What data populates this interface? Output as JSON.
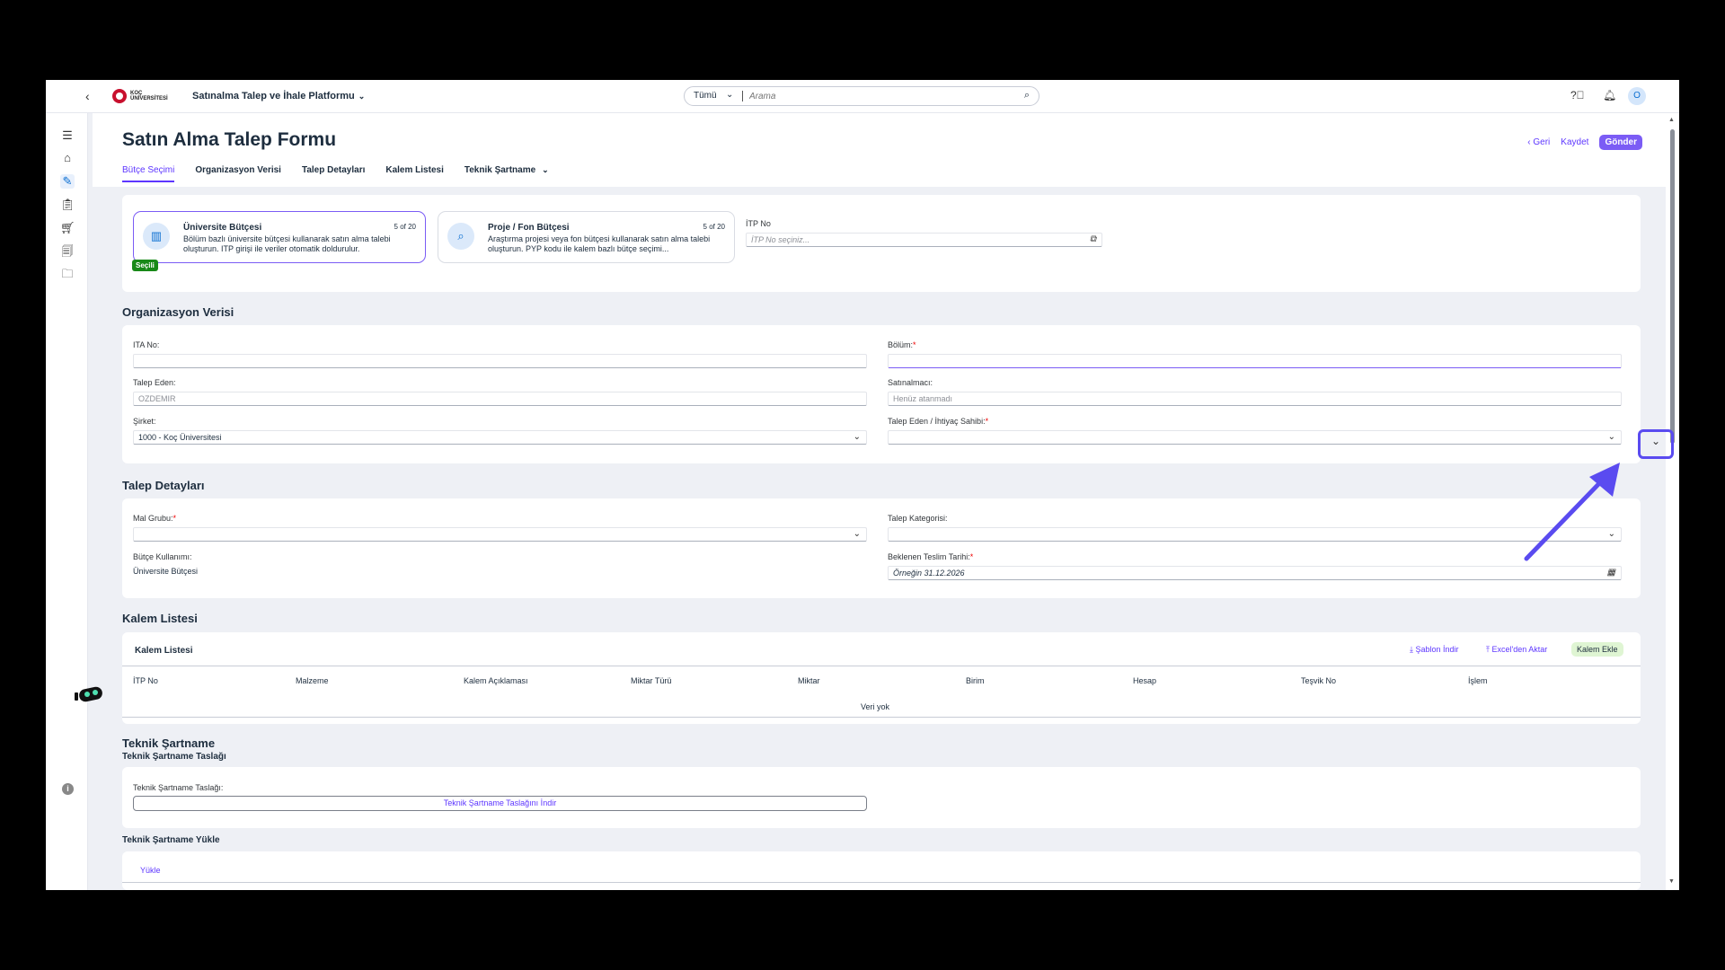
{
  "shell": {
    "logo_line1": "KOÇ",
    "logo_line2": "ÜNİVERSİTESİ",
    "app_title": "Satınalma Talep ve İhale Platformu",
    "search_scope": "Tümü",
    "search_placeholder": "Arama",
    "avatar_initial": "O"
  },
  "header": {
    "title": "Satın Alma Talep Formu",
    "back_label": "Geri",
    "save_label": "Kaydet",
    "submit_label": "Gönder",
    "tabs": [
      {
        "label": "Bütçe Seçimi"
      },
      {
        "label": "Organizasyon Verisi"
      },
      {
        "label": "Talep Detayları"
      },
      {
        "label": "Kalem Listesi"
      },
      {
        "label": "Teknik Şartname"
      }
    ]
  },
  "budget": {
    "tiles": [
      {
        "title": "Üniversite Bütçesi",
        "count": "5 of 20",
        "desc": "Bölüm bazlı üniversite bütçesi kullanarak satın alma talebi oluşturun. ITP girişi ile veriler otomatik doldurulur."
      },
      {
        "title": "Proje / Fon Bütçesi",
        "count": "5 of 20",
        "desc": "Araştırma projesi veya fon bütçesi kullanarak satın alma talebi oluşturun. PYP kodu ile kalem bazlı bütçe seçimi..."
      }
    ],
    "selected_badge": "Seçili",
    "itp_label": "İTP No",
    "itp_placeholder": "İTP No seçiniz..."
  },
  "org": {
    "section_title": "Organizasyon Verisi",
    "ita_label": "ITA No:",
    "bolum_label": "Bölüm:",
    "talep_eden_label": "Talep Eden:",
    "talep_eden_value": "OZDEMIR",
    "satinalmaci_label": "Satınalmacı:",
    "satinalmaci_value": "Henüz atanmadı",
    "sirket_label": "Şirket:",
    "sirket_value": "1000 - Koç Üniversitesi",
    "ihtiyac_label": "Talep Eden / İhtiyaç Sahibi:"
  },
  "details": {
    "section_title": "Talep Detayları",
    "mal_grubu_label": "Mal Grubu:",
    "kategori_label": "Talep Kategorisi:",
    "butce_label": "Bütçe Kullanımı:",
    "butce_value": "Üniversite Bütçesi",
    "teslim_label": "Beklenen Teslim Tarihi:",
    "teslim_placeholder": "Örneğin 31.12.2026"
  },
  "items": {
    "section_title": "Kalem Listesi",
    "table_title": "Kalem Listesi",
    "template_link": "Şablon İndir",
    "excel_link": "Excel'den Aktar",
    "add_button": "Kalem Ekle",
    "columns": [
      "İTP No",
      "Malzeme",
      "Kalem Açıklaması",
      "Miktar Türü",
      "Miktar",
      "Birim",
      "Hesap",
      "Teşvik No",
      "İşlem"
    ],
    "empty_text": "Veri yok"
  },
  "spec": {
    "section_title": "Teknik Şartname",
    "draft_title": "Teknik Şartname Taslağı",
    "draft_label": "Teknik Şartname Taslağı:",
    "draft_button": "Teknik Şartname Taslağını İndir",
    "upload_title": "Teknik Şartname Yükle",
    "upload_link": "Yükle"
  },
  "colors": {
    "accent": "#5d36ff",
    "primary_button": "#7b5cf5",
    "selected_badge": "#188918",
    "annotation": "#5a4bf0"
  }
}
